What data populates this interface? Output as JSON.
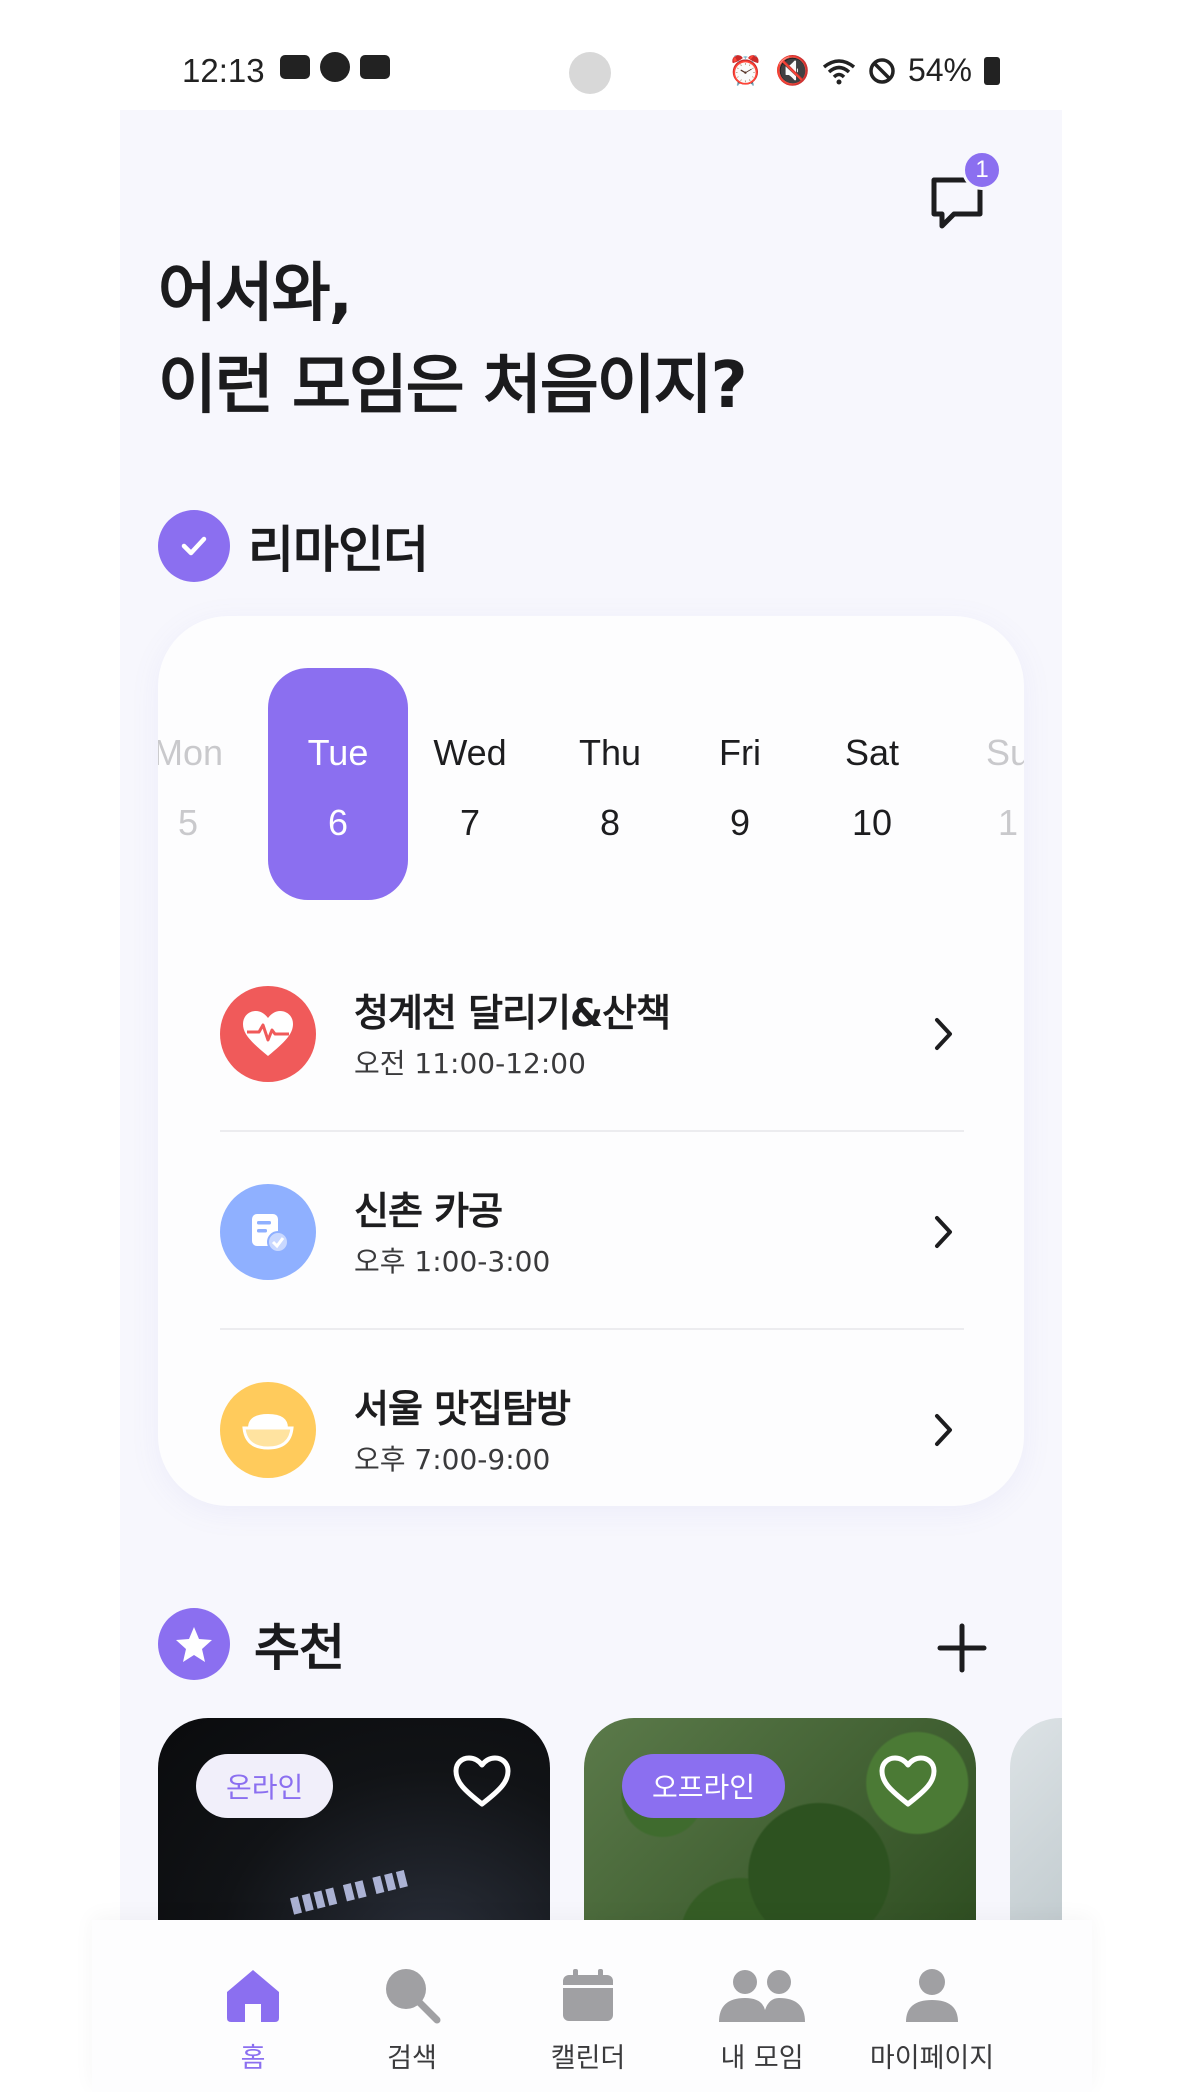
{
  "colors": {
    "accent": "#8b6ff0",
    "heart_red": "#f05a5a",
    "blue": "#8fb0ff",
    "yellow": "#ffcb5c",
    "background": "#f7f7fd"
  },
  "status_bar": {
    "time": "12:13",
    "battery": "54%"
  },
  "header": {
    "chat_icon": "chat-bubble-icon",
    "chat_badge_count": "1"
  },
  "headline": {
    "line1": "어서와,",
    "line2": "이런 모임은 처음이지?"
  },
  "reminder": {
    "title": "리마인더",
    "week": [
      {
        "day": "Mon",
        "date": "5"
      },
      {
        "day": "Tue",
        "date": "6"
      },
      {
        "day": "Wed",
        "date": "7"
      },
      {
        "day": "Thu",
        "date": "8"
      },
      {
        "day": "Fri",
        "date": "9"
      },
      {
        "day": "Sat",
        "date": "10"
      },
      {
        "day": "Su",
        "date": "1"
      }
    ],
    "selected_day": "Tue",
    "events": [
      {
        "title": "청계천 달리기&산책",
        "time": "오전 11:00-12:00",
        "icon": "heart-pulse-icon"
      },
      {
        "title": "신촌 카공",
        "time": "오후 1:00-3:00",
        "icon": "document-check-icon"
      },
      {
        "title": "서울 맛집탐방",
        "time": "오후 7:00-9:00",
        "icon": "rice-bowl-icon"
      }
    ]
  },
  "recommend": {
    "title": "추천",
    "cards": [
      {
        "tag": "온라인"
      },
      {
        "tag": "오프라인"
      }
    ]
  },
  "bottom_nav": [
    {
      "label": "홈",
      "icon": "home-icon",
      "active": true
    },
    {
      "label": "검색",
      "icon": "search-icon",
      "active": false
    },
    {
      "label": "캘린더",
      "icon": "calendar-icon",
      "active": false
    },
    {
      "label": "내 모임",
      "icon": "group-icon",
      "active": false
    },
    {
      "label": "마이페이지",
      "icon": "person-icon",
      "active": false
    }
  ]
}
